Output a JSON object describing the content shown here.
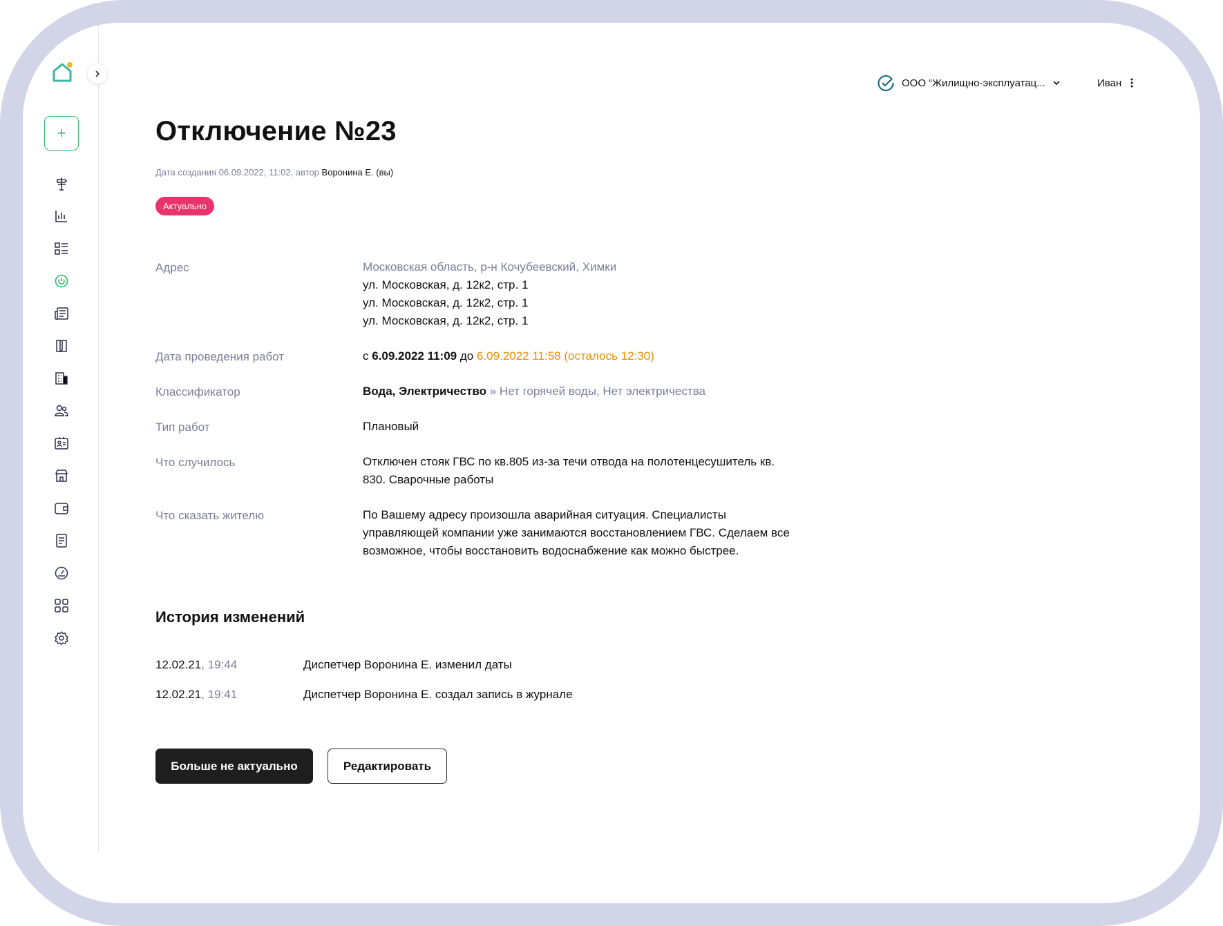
{
  "header": {
    "org_name": "ООО “Жилищно-эксплуатац...",
    "user_name": "Иван"
  },
  "sidebar": {
    "add_label": "+",
    "items": [
      {
        "icon": "signpost-icon"
      },
      {
        "icon": "chart-icon"
      },
      {
        "icon": "list-icon"
      },
      {
        "icon": "power-icon",
        "active": true
      },
      {
        "icon": "newspaper-icon"
      },
      {
        "icon": "book-icon"
      },
      {
        "icon": "building-icon"
      },
      {
        "icon": "users-icon"
      },
      {
        "icon": "id-card-icon"
      },
      {
        "icon": "store-icon"
      },
      {
        "icon": "wallet-icon"
      },
      {
        "icon": "document-icon"
      },
      {
        "icon": "gauge-icon"
      },
      {
        "icon": "grid-icon"
      },
      {
        "icon": "settings-icon"
      }
    ]
  },
  "page": {
    "title": "Отключение №23",
    "meta_prefix": "Дата создания 06.09.2022, 11:02, автор",
    "meta_author": "Воронина Е. (вы)",
    "status_badge": "Актуально"
  },
  "details": {
    "address": {
      "label": "Адрес",
      "region": "Московская область, р-н Кочубеевский, Химки",
      "lines": [
        "ул. Московская, д. 12к2, стр. 1",
        "ул. Московская, д. 12к2, стр. 1",
        "ул. Московская, д. 12к2, стр. 1"
      ]
    },
    "work_date": {
      "label": "Дата проведения работ",
      "from_prefix": "с",
      "from": "6.09.2022 11:09",
      "to_prefix": "до",
      "to": "6.09.2022 11:58 (осталось 12:30)"
    },
    "classifier": {
      "label": "Классификатор",
      "main": "Вода, Электричество",
      "sub": "» Нет горячей воды, Нет электричества"
    },
    "work_type": {
      "label": "Тип работ",
      "value": "Плановый"
    },
    "what_happened": {
      "label": "Что случилось",
      "value": "Отключен стояк ГВС по кв.805 из-за течи отвода на полотенцесушитель кв. 830. Сварочные работы"
    },
    "resident_message": {
      "label": "Что сказать жителю",
      "value": "По Вашему адресу произошла аварийная ситуация. Специалисты управляющей компании уже занимаются восстановлением ГВС. Сделаем все возможное, чтобы восстановить водоснабжение как можно быстрее."
    }
  },
  "history": {
    "title": "История изменений",
    "entries": [
      {
        "date": "12.02.21",
        "time": ", 19:44",
        "text": "Диспетчер Воронина Е. изменил даты"
      },
      {
        "date": "12.02.21",
        "time": ", 19:41",
        "text": "Диспетчер Воронина Е. создал запись в журнале"
      }
    ]
  },
  "actions": {
    "primary": "Больше не актуально",
    "secondary": "Редактировать"
  },
  "colors": {
    "accent_green": "#2fb86a",
    "badge_red": "#e8346a",
    "warning_orange": "#f28c00",
    "muted": "#7a7f99",
    "frame_bg": "#d2d5e8"
  }
}
